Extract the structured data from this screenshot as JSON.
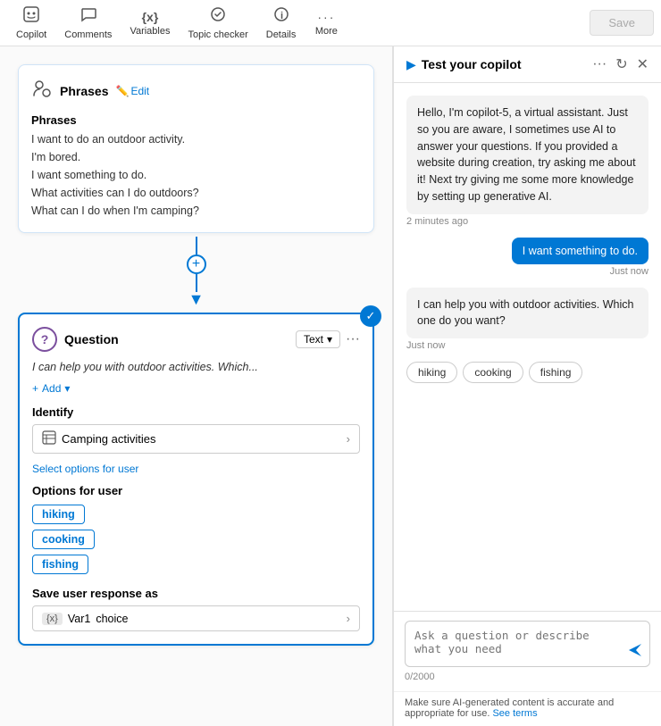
{
  "toolbar": {
    "items": [
      {
        "id": "copilot",
        "icon": "🤖",
        "label": "Copilot"
      },
      {
        "id": "comments",
        "icon": "💬",
        "label": "Comments"
      },
      {
        "id": "variables",
        "icon": "{x}",
        "label": "Variables"
      },
      {
        "id": "topic-checker",
        "icon": "✓",
        "label": "Topic checker"
      },
      {
        "id": "details",
        "icon": "ℹ",
        "label": "Details"
      },
      {
        "id": "more",
        "icon": "···",
        "label": "More"
      }
    ],
    "save_label": "Save"
  },
  "phrases_card": {
    "title": "Phrases",
    "edit_label": "Edit",
    "phrases_heading": "Phrases",
    "phrases": [
      "I want to do an outdoor activity.",
      "I'm bored.",
      "I want something to do.",
      "What activities can I do outdoors?",
      "What can I do when I'm camping?"
    ]
  },
  "question_card": {
    "title": "Question",
    "type_label": "Text",
    "question_preview": "I can help you with outdoor activities. Which...",
    "add_label": "Add",
    "identify_label": "Identify",
    "identify_value": "Camping activities",
    "select_options_label": "Select options for user",
    "options_for_user_label": "Options for user",
    "options": [
      "hiking",
      "cooking",
      "fishing"
    ],
    "save_response_label": "Save user response as",
    "var_name": "Var1",
    "choice_label": "choice"
  },
  "test_panel": {
    "title": "Test your copilot",
    "messages": [
      {
        "type": "bot",
        "text": "Hello, I'm copilot-5, a virtual assistant. Just so you are aware, I sometimes use AI to answer your questions. If you provided a website during creation, try asking me about it! Next try giving me some more knowledge by setting up generative AI.",
        "time": "2 minutes ago"
      },
      {
        "type": "user",
        "text": "I want something to do.",
        "time": "Just now"
      },
      {
        "type": "bot",
        "text": "I can help you with outdoor activities. Which one do you want?",
        "time": "Just now"
      }
    ],
    "chat_options": [
      "hiking",
      "cooking",
      "fishing"
    ],
    "input_placeholder": "Ask a question or describe what you need",
    "char_count": "0/2000",
    "disclaimer": "Make sure AI-generated content is accurate and appropriate for use.",
    "see_terms": "See terms"
  }
}
